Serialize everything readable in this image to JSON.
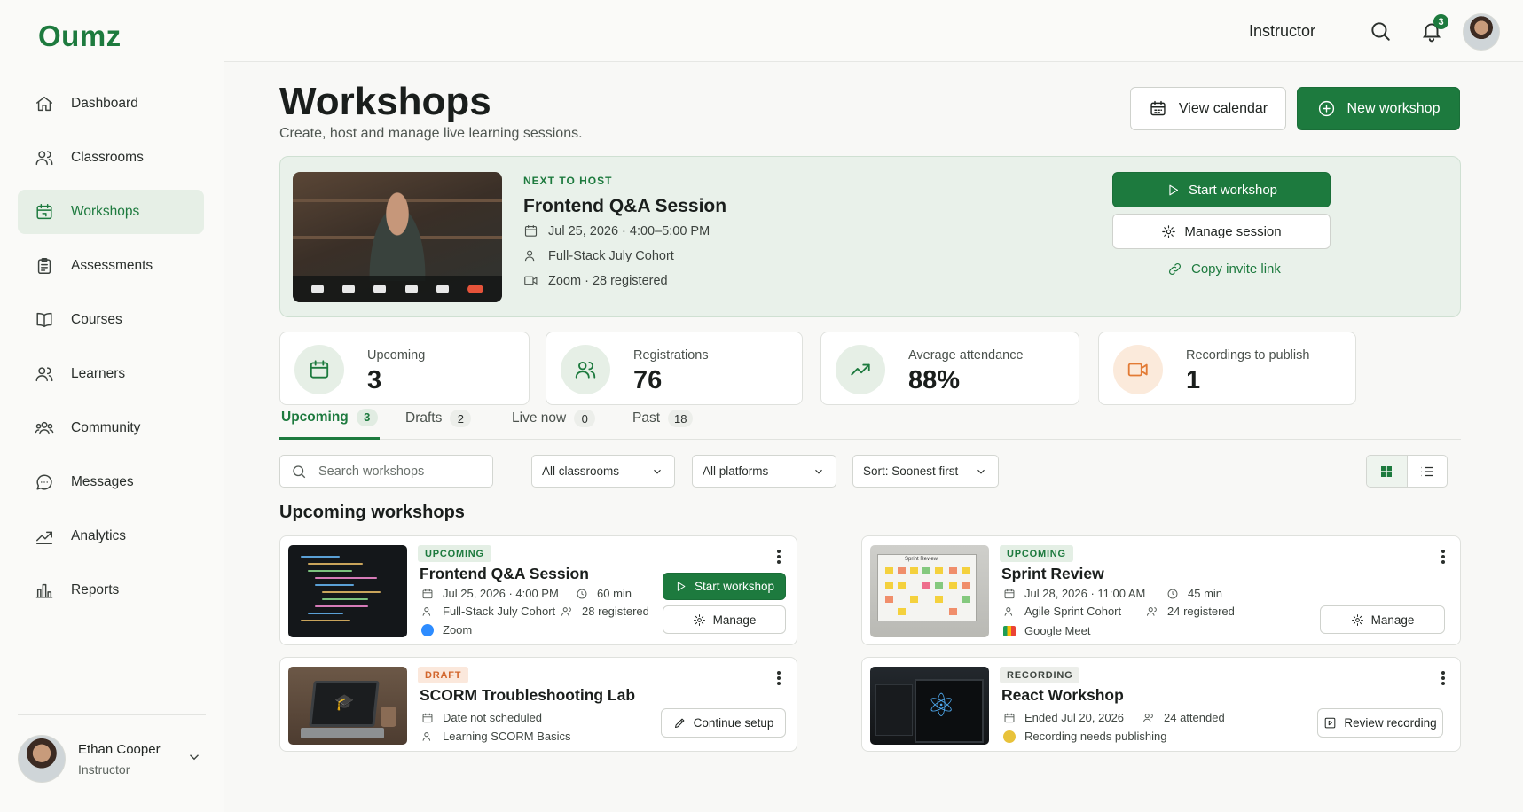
{
  "app": {
    "logo": "Oumz"
  },
  "sidebar": {
    "items": [
      {
        "label": "Dashboard",
        "icon": "home-icon"
      },
      {
        "label": "Classrooms",
        "icon": "users-icon"
      },
      {
        "label": "Workshops",
        "icon": "calendar-icon",
        "active": true
      },
      {
        "label": "Assessments",
        "icon": "clipboard-icon"
      },
      {
        "label": "Courses",
        "icon": "book-icon"
      },
      {
        "label": "Learners",
        "icon": "learners-icon"
      },
      {
        "label": "Community",
        "icon": "community-icon"
      },
      {
        "label": "Messages",
        "icon": "chat-icon"
      },
      {
        "label": "Analytics",
        "icon": "analytics-icon"
      },
      {
        "label": "Reports",
        "icon": "bar-chart-icon"
      }
    ],
    "user": {
      "name": "Ethan Cooper",
      "role": "Instructor"
    }
  },
  "topbar": {
    "role": "Instructor",
    "notification_count": "3"
  },
  "header": {
    "title": "Workshops",
    "subtitle": "Create, host and manage live learning sessions.",
    "view_calendar": "View calendar",
    "new_workshop": "New workshop"
  },
  "hero": {
    "eyebrow": "NEXT TO HOST",
    "title": "Frontend Q&A Session",
    "datetime": "Jul 25, 2026 · 4:00–5:00 PM",
    "cohort": "Full-Stack July Cohort",
    "platform": "Zoom · 28 registered",
    "start": "Start workshop",
    "manage": "Manage session",
    "copy": "Copy invite link"
  },
  "stats": [
    {
      "label": "Upcoming",
      "value": "3"
    },
    {
      "label": "Registrations",
      "value": "76"
    },
    {
      "label": "Average attendance",
      "value": "88%"
    },
    {
      "label": "Recordings to publish",
      "value": "1"
    }
  ],
  "tabs": [
    {
      "label": "Upcoming",
      "count": "3"
    },
    {
      "label": "Drafts",
      "count": "2"
    },
    {
      "label": "Live now",
      "count": "0"
    },
    {
      "label": "Past",
      "count": "18"
    }
  ],
  "filters": {
    "search_placeholder": "Search workshops",
    "classrooms": "All classrooms",
    "platforms": "All platforms",
    "sort": "Sort: Soonest first"
  },
  "section_title": "Upcoming workshops",
  "cards": [
    {
      "badge": "UPCOMING",
      "title": "Frontend Q&A Session",
      "date": "Jul 25, 2026 · 4:00 PM",
      "duration": "60 min",
      "cohort": "Full-Stack July Cohort",
      "registered": "28 registered",
      "platform": "Zoom",
      "primary": "Start workshop",
      "secondary": "Manage"
    },
    {
      "badge": "UPCOMING",
      "title": "Sprint Review",
      "date": "Jul 28, 2026 · 11:00 AM",
      "duration": "45 min",
      "cohort": "Agile Sprint Cohort",
      "registered": "24 registered",
      "platform": "Google Meet",
      "secondary": "Manage",
      "thumb_label": "Sprint Review"
    },
    {
      "badge": "DRAFT",
      "title": "SCORM Troubleshooting Lab",
      "date": "Date not scheduled",
      "cohort": "Learning SCORM Basics",
      "secondary": "Continue setup"
    },
    {
      "badge": "RECORDING",
      "title": "React Workshop",
      "date": "Ended Jul 20, 2026",
      "attended": "24 attended",
      "status": "Recording needs publishing",
      "secondary": "Review recording"
    }
  ],
  "colors": {
    "brand": "#1d7a3e",
    "draft": "#d2662d",
    "recording_orange": "#e27b35"
  }
}
